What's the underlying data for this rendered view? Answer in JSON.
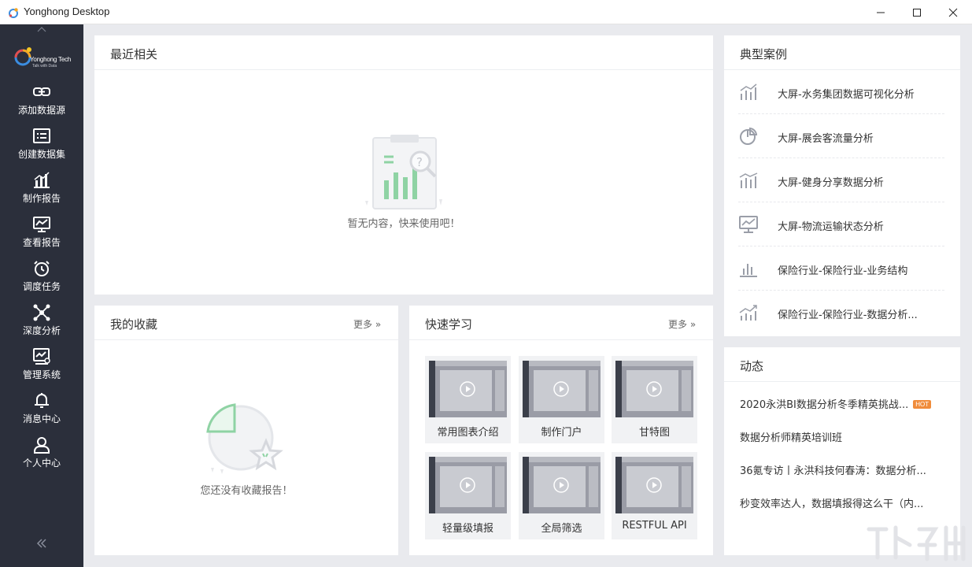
{
  "window": {
    "title": "Yonghong Desktop",
    "controls": [
      "minimize-icon",
      "maximize-icon",
      "close-icon"
    ]
  },
  "sidebar": {
    "logo": {
      "brand": "Yonghong Tech",
      "slogan": "Talk with Data"
    },
    "items": [
      {
        "label": "添加数据源",
        "icon": "link-icon"
      },
      {
        "label": "创建数据集",
        "icon": "dataset-icon"
      },
      {
        "label": "制作报告",
        "icon": "bar-chart-icon"
      },
      {
        "label": "查看报告",
        "icon": "monitor-chart-icon"
      },
      {
        "label": "调度任务",
        "icon": "alarm-clock-icon"
      },
      {
        "label": "深度分析",
        "icon": "network-icon"
      },
      {
        "label": "管理系统",
        "icon": "admin-monitor-icon"
      },
      {
        "label": "消息中心",
        "icon": "bell-icon"
      },
      {
        "label": "个人中心",
        "icon": "user-icon"
      }
    ]
  },
  "recent": {
    "title": "最近相关",
    "empty_text": "暂无内容，快来使用吧！"
  },
  "favorites": {
    "title": "我的收藏",
    "more": "更多",
    "empty_text": "您还没有收藏报告！"
  },
  "learn": {
    "title": "快速学习",
    "more": "更多",
    "videos": [
      {
        "label": "常用图表介绍"
      },
      {
        "label": "制作门户"
      },
      {
        "label": "甘特图"
      },
      {
        "label": "轻量级填报"
      },
      {
        "label": "全局筛选"
      },
      {
        "label": "RESTFUL API"
      }
    ]
  },
  "cases": {
    "title": "典型案例",
    "items": [
      {
        "label": "大屏-水务集团数据可视化分析",
        "icon": "bar-trend-icon"
      },
      {
        "label": "大屏-展会客流量分析",
        "icon": "pie-chart-icon"
      },
      {
        "label": "大屏-健身分享数据分析",
        "icon": "bar-line-icon"
      },
      {
        "label": "大屏-物流运输状态分析",
        "icon": "monitor-chart-icon"
      },
      {
        "label": "保险行业-保险行业-业务结构",
        "icon": "bar-chart-icon"
      },
      {
        "label": "保险行业-保险行业-数据分析...",
        "icon": "trend-arrow-icon"
      }
    ]
  },
  "news": {
    "title": "动态",
    "hot_badge": "HOT",
    "items": [
      {
        "label": "2020永洪BI数据分析冬季精英挑战..."
      },
      {
        "label": "数据分析师精英培训班"
      },
      {
        "label": "36氪专访丨永洪科技何春涛：数据分析..."
      },
      {
        "label": "秒变效率达人，数据填报得这么干（内..."
      }
    ]
  },
  "colors": {
    "sidebar_bg": "#2b2f3b",
    "page_bg": "#e9eaee",
    "empty_green": "#8fd3a4",
    "hot_badge": "#f08c3b"
  }
}
